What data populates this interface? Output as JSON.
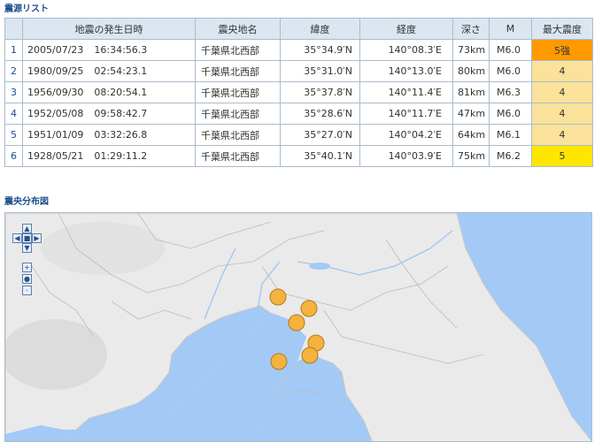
{
  "list_title": "震源リスト",
  "table": {
    "headers": [
      "",
      "地震の発生日時",
      "震央地名",
      "緯度",
      "経度",
      "深さ",
      "M",
      "最大震度"
    ],
    "rows": [
      {
        "no": "1",
        "date": "2005/07/23",
        "time": "16:34:56.3",
        "place": "千葉県北西部",
        "lat": "35°34.9′N",
        "lon": "140°08.3′E",
        "depth": "73km",
        "mag": "M6.0",
        "intensity": "5強",
        "intensity_color": "#ff9900"
      },
      {
        "no": "2",
        "date": "1980/09/25",
        "time": "02:54:23.1",
        "place": "千葉県北西部",
        "lat": "35°31.0′N",
        "lon": "140°13.0′E",
        "depth": "80km",
        "mag": "M6.0",
        "intensity": "4",
        "intensity_color": "#fae29a"
      },
      {
        "no": "3",
        "date": "1956/09/30",
        "time": "08:20:54.1",
        "place": "千葉県北西部",
        "lat": "35°37.8′N",
        "lon": "140°11.4′E",
        "depth": "81km",
        "mag": "M6.3",
        "intensity": "4",
        "intensity_color": "#fae29a"
      },
      {
        "no": "4",
        "date": "1952/05/08",
        "time": "09:58:42.7",
        "place": "千葉県北西部",
        "lat": "35°28.6′N",
        "lon": "140°11.7′E",
        "depth": "47km",
        "mag": "M6.0",
        "intensity": "4",
        "intensity_color": "#fae29a"
      },
      {
        "no": "5",
        "date": "1951/01/09",
        "time": "03:32:26.8",
        "place": "千葉県北西部",
        "lat": "35°27.0′N",
        "lon": "140°04.2′E",
        "depth": "64km",
        "mag": "M6.1",
        "intensity": "4",
        "intensity_color": "#fae29a"
      },
      {
        "no": "6",
        "date": "1928/05/21",
        "time": "01:29:11.2",
        "place": "千葉県北西部",
        "lat": "35°40.1′N",
        "lon": "140°03.9′E",
        "depth": "75km",
        "mag": "M6.2",
        "intensity": "5",
        "intensity_color": "#ffe600"
      }
    ]
  },
  "map_title": "震央分布図",
  "map": {
    "epicenter_color": "#f6b23e",
    "epicenter_stroke": "#b07a1a",
    "sea_color": "#a3c9f7",
    "land_color": "#eaeaea",
    "nav_icons": [
      "arrow-up-icon",
      "arrow-left-icon",
      "arrow-right-icon",
      "arrow-down-icon",
      "zoom-in-icon",
      "zoom-reset-icon",
      "zoom-out-icon"
    ]
  }
}
